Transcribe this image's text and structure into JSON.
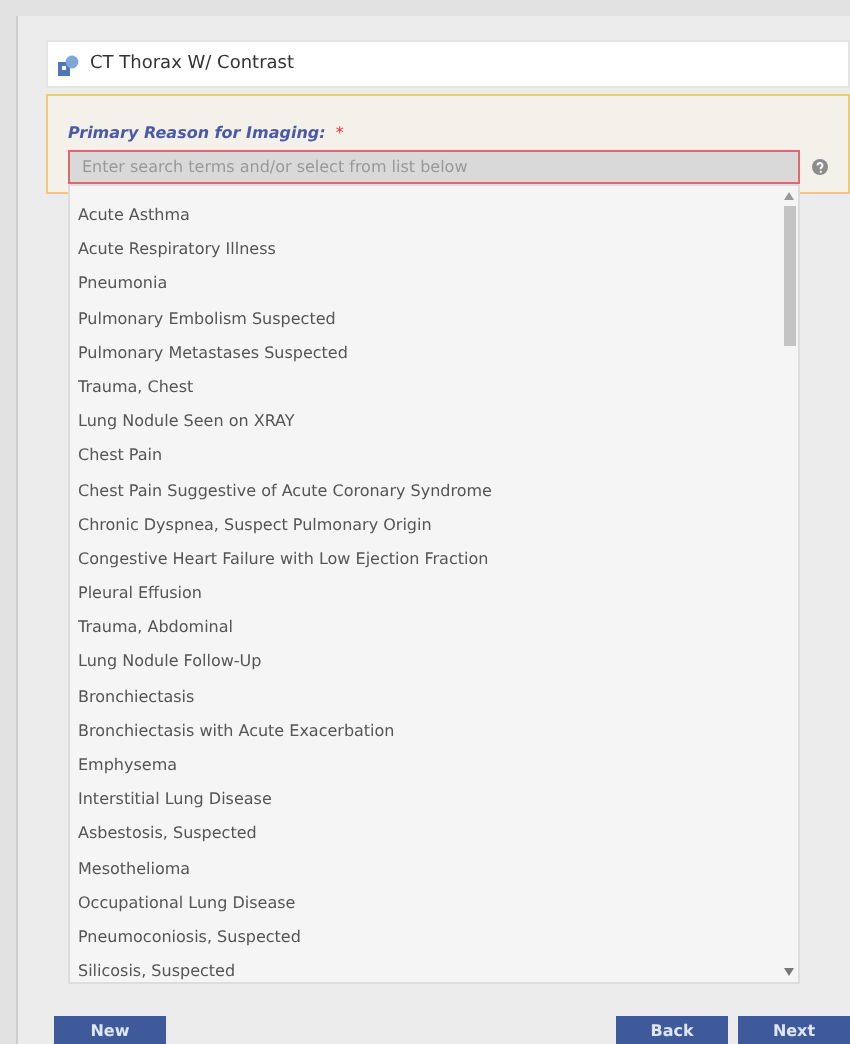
{
  "header": {
    "title": "CT Thorax W/ Contrast"
  },
  "field": {
    "label": "Primary Reason for Imaging:",
    "required_mark": "*",
    "placeholder": "Enter search terms and/or select from list below"
  },
  "options": [
    "Acute Asthma",
    "Acute Respiratory Illness",
    "Pneumonia",
    "Pulmonary Embolism Suspected",
    "Pulmonary Metastases Suspected",
    "Trauma, Chest",
    "Lung Nodule Seen on XRAY",
    "Chest Pain",
    "Chest Pain Suggestive of Acute Coronary Syndrome",
    "Chronic Dyspnea, Suspect Pulmonary Origin",
    "Congestive Heart Failure with Low Ejection Fraction",
    "Pleural Effusion",
    "Trauma, Abdominal",
    "Lung Nodule Follow-Up",
    "Bronchiectasis",
    "Bronchiectasis with Acute Exacerbation",
    "Emphysema",
    "Interstitial Lung Disease",
    "Asbestosis, Suspected",
    "Mesothelioma",
    "Occupational Lung Disease",
    "Pneumoconiosis, Suspected",
    "Silicosis, Suspected"
  ],
  "buttons": {
    "left": [
      "New"
    ],
    "right": [
      "Back",
      "Next"
    ]
  }
}
